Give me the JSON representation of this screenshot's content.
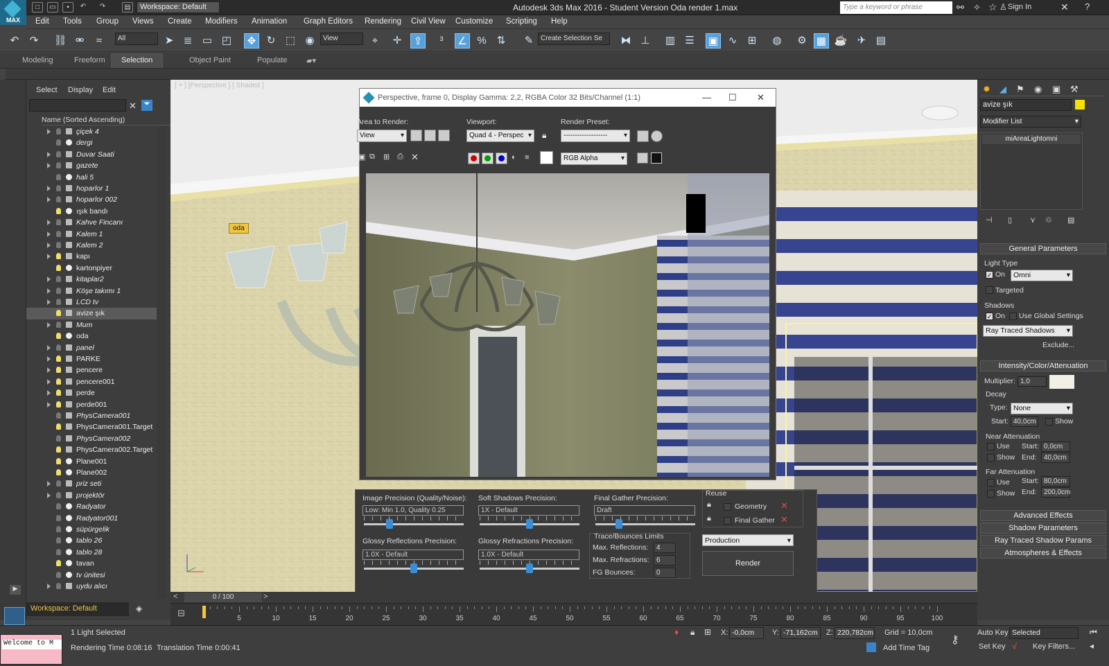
{
  "app": {
    "title": "Autodesk 3ds Max 2016 - Student Version     Oda render 1.max",
    "workspace": "Workspace: Default",
    "search_placeholder": "Type a keyword or phrase",
    "signin": "Sign In",
    "logo": "MAX"
  },
  "menus": [
    "Edit",
    "Tools",
    "Group",
    "Views",
    "Create",
    "Modifiers",
    "Animation",
    "Graph Editors",
    "Rendering",
    "Civil View",
    "Customize",
    "Scripting",
    "Help"
  ],
  "toolbar": {
    "filter": "All",
    "coord": "View",
    "selset": "Create Selection Se"
  },
  "ribbon": {
    "tabs": [
      "Modeling",
      "Freeform",
      "Selection",
      "Object Paint",
      "Populate"
    ],
    "active": "Selection"
  },
  "scene_explorer": {
    "tabs": [
      "Select",
      "Display",
      "Edit"
    ],
    "header": "Name (Sorted Ascending)",
    "workspace": "Workspace: Default",
    "items": [
      {
        "name": "çiçek 4",
        "exp": true,
        "light": false,
        "type": "grp",
        "italic": true
      },
      {
        "name": "dergi",
        "exp": false,
        "light": false,
        "type": "obj",
        "italic": true
      },
      {
        "name": "Duvar Saati",
        "exp": true,
        "light": false,
        "type": "grp",
        "italic": true
      },
      {
        "name": "gazete",
        "exp": true,
        "light": false,
        "type": "grp",
        "italic": true
      },
      {
        "name": "hali 5",
        "exp": false,
        "light": false,
        "type": "obj",
        "italic": true
      },
      {
        "name": "hoparlor 1",
        "exp": true,
        "light": false,
        "type": "grp",
        "italic": true
      },
      {
        "name": "hoparlor 002",
        "exp": true,
        "light": false,
        "type": "grp",
        "italic": true
      },
      {
        "name": "ışık bandı",
        "exp": false,
        "light": true,
        "type": "obj",
        "italic": false
      },
      {
        "name": "Kahve Fincanı",
        "exp": true,
        "light": false,
        "type": "grp",
        "italic": true
      },
      {
        "name": "Kalem 1",
        "exp": true,
        "light": false,
        "type": "grp",
        "italic": true
      },
      {
        "name": "Kalem 2",
        "exp": true,
        "light": false,
        "type": "grp",
        "italic": true
      },
      {
        "name": "kapı",
        "exp": true,
        "light": true,
        "type": "grp",
        "italic": false
      },
      {
        "name": "kartonpiyer",
        "exp": false,
        "light": true,
        "type": "obj",
        "italic": false
      },
      {
        "name": "kitaplar2",
        "exp": true,
        "light": false,
        "type": "grp",
        "italic": true
      },
      {
        "name": "Köşe takımı 1",
        "exp": true,
        "light": false,
        "type": "grp",
        "italic": true
      },
      {
        "name": "LCD tv",
        "exp": true,
        "light": false,
        "type": "grp",
        "italic": true
      },
      {
        "name": "avize şık",
        "exp": false,
        "light": true,
        "type": "grp",
        "italic": false,
        "sel": true
      },
      {
        "name": "Mum",
        "exp": true,
        "light": false,
        "type": "grp",
        "italic": true
      },
      {
        "name": "oda",
        "exp": false,
        "light": true,
        "type": "obj",
        "italic": false
      },
      {
        "name": "panel",
        "exp": true,
        "light": false,
        "type": "grp",
        "italic": true
      },
      {
        "name": "PARKE",
        "exp": true,
        "light": true,
        "type": "grp",
        "italic": false
      },
      {
        "name": "pencere",
        "exp": true,
        "light": true,
        "type": "grp",
        "italic": false
      },
      {
        "name": "pencere001",
        "exp": true,
        "light": true,
        "type": "grp",
        "italic": false
      },
      {
        "name": "perde",
        "exp": true,
        "light": true,
        "type": "grp",
        "italic": false
      },
      {
        "name": "perde001",
        "exp": true,
        "light": true,
        "type": "grp",
        "italic": false
      },
      {
        "name": "PhysCamera001",
        "exp": false,
        "light": false,
        "type": "grp",
        "italic": true
      },
      {
        "name": "PhysCamera001.Target",
        "exp": false,
        "light": true,
        "type": "grp",
        "italic": false
      },
      {
        "name": "PhysCamera002",
        "exp": false,
        "light": false,
        "type": "grp",
        "italic": true
      },
      {
        "name": "PhysCamera002.Target",
        "exp": false,
        "light": true,
        "type": "grp",
        "italic": false
      },
      {
        "name": "Plane001",
        "exp": false,
        "light": true,
        "type": "obj",
        "italic": false
      },
      {
        "name": "Plane002",
        "exp": false,
        "light": true,
        "type": "obj",
        "italic": false
      },
      {
        "name": "priz seti",
        "exp": true,
        "light": false,
        "type": "grp",
        "italic": true
      },
      {
        "name": "projektör",
        "exp": true,
        "light": false,
        "type": "grp",
        "italic": true
      },
      {
        "name": "Radyator",
        "exp": false,
        "light": false,
        "type": "obj",
        "italic": true
      },
      {
        "name": "Radyator001",
        "exp": false,
        "light": false,
        "type": "obj",
        "italic": true
      },
      {
        "name": "süpürgelik",
        "exp": false,
        "light": false,
        "type": "obj",
        "italic": true
      },
      {
        "name": "tablo 26",
        "exp": false,
        "light": false,
        "type": "obj",
        "italic": true
      },
      {
        "name": "tablo 28",
        "exp": false,
        "light": false,
        "type": "obj",
        "italic": true
      },
      {
        "name": "tavan",
        "exp": false,
        "light": true,
        "type": "obj",
        "italic": false
      },
      {
        "name": "tv ünitesi",
        "exp": false,
        "light": false,
        "type": "obj",
        "italic": true
      },
      {
        "name": "uydu alıcı",
        "exp": true,
        "light": false,
        "type": "grp",
        "italic": true
      }
    ]
  },
  "viewport": {
    "label": "[ + ] [Perspective ] [ Shaded ]",
    "tag": "oda"
  },
  "render_frame": {
    "title": "Perspective, frame 0, Display Gamma: 2,2, RGBA Color 32 Bits/Channel (1:1)",
    "area_label": "Area to Render:",
    "area": "View",
    "viewport_label": "Viewport:",
    "viewport": "Quad 4 - Perspec",
    "preset_label": "Render Preset:",
    "preset": "-------------------",
    "channel": "RGB Alpha"
  },
  "render_params": {
    "img_prec_label": "Image Precision (Quality/Noise):",
    "img_prec": "Low: Min 1.0, Quality 0.25",
    "img_prec_pos": 0.24,
    "soft_label": "Soft Shadows Precision:",
    "soft": "1X - Default",
    "soft_pos": 0.5,
    "fg_label": "Final Gather Precision:",
    "fg": "Draft",
    "fg_pos": 0.22,
    "glossy_refl_label": "Glossy Reflections Precision:",
    "glossy_refl": "1.0X - Default",
    "glossy_refl_pos": 0.5,
    "glossy_refr_label": "Glossy Refractions Precision:",
    "glossy_refr": "1.0X - Default",
    "glossy_refr_pos": 0.5,
    "reuse_label": "Reuse",
    "geometry": "Geometry",
    "final_gather": "Final Gather",
    "trace_label": "Trace/Bounces Limits",
    "max_refl_label": "Max. Reflections:",
    "max_refl": "4",
    "max_refr_label": "Max. Refractions:",
    "max_refr": "6",
    "fg_bounce_label": "FG Bounces:",
    "fg_bounce": "0",
    "mode": "Production",
    "render": "Render"
  },
  "command_panel": {
    "name": "avize şık",
    "modifier_list": "Modifier List",
    "stack_item": "miAreaLightomni",
    "general": "General Parameters",
    "light_type": "Light Type",
    "on": "On",
    "type": "Omni",
    "targeted": "Targeted",
    "shadows": "Shadows",
    "use_global": "Use Global Settings",
    "shadow_type": "Ray Traced Shadows",
    "exclude": "Exclude...",
    "intensity": "Intensity/Color/Attenuation",
    "multiplier_label": "Multiplier:",
    "multiplier": "1,0",
    "decay": "Decay",
    "decay_type_label": "Type:",
    "decay_type": "None",
    "start_label": "Start:",
    "decay_start": "40,0cm",
    "show": "Show",
    "near": "Near Attenuation",
    "use": "Use",
    "near_start": "0,0cm",
    "end_label": "End:",
    "near_end": "40,0cm",
    "far": "Far Attenuation",
    "far_start": "80,0cm",
    "far_end": "200,0cm",
    "rollouts": [
      "Advanced Effects",
      "Shadow Parameters",
      "Ray Traced Shadow Params",
      "Atmospheres & Effects"
    ],
    "color_name_swatch": "#f5e000",
    "color_light": "#f2f0e6"
  },
  "timeline": {
    "frame": "0 / 100",
    "ticks": [
      5,
      10,
      15,
      20,
      25,
      30,
      35,
      40,
      45,
      50,
      55,
      60,
      65,
      70,
      75,
      80,
      85,
      90,
      95,
      100
    ]
  },
  "status": {
    "selection": "1 Light Selected",
    "render_time": "Rendering Time  0:08:16",
    "translation_time": "Translation Time  0:00:41",
    "x": "-0,0cm",
    "y": "-71,162cm",
    "z": "220,782cm",
    "grid": "Grid = 10,0cm",
    "add_time_tag": "Add Time Tag",
    "auto_key": "Auto Key",
    "selected": "Selected",
    "set_key": "Set Key",
    "key_filters": "Key Filters...",
    "maxscript": "Welcome to M"
  }
}
